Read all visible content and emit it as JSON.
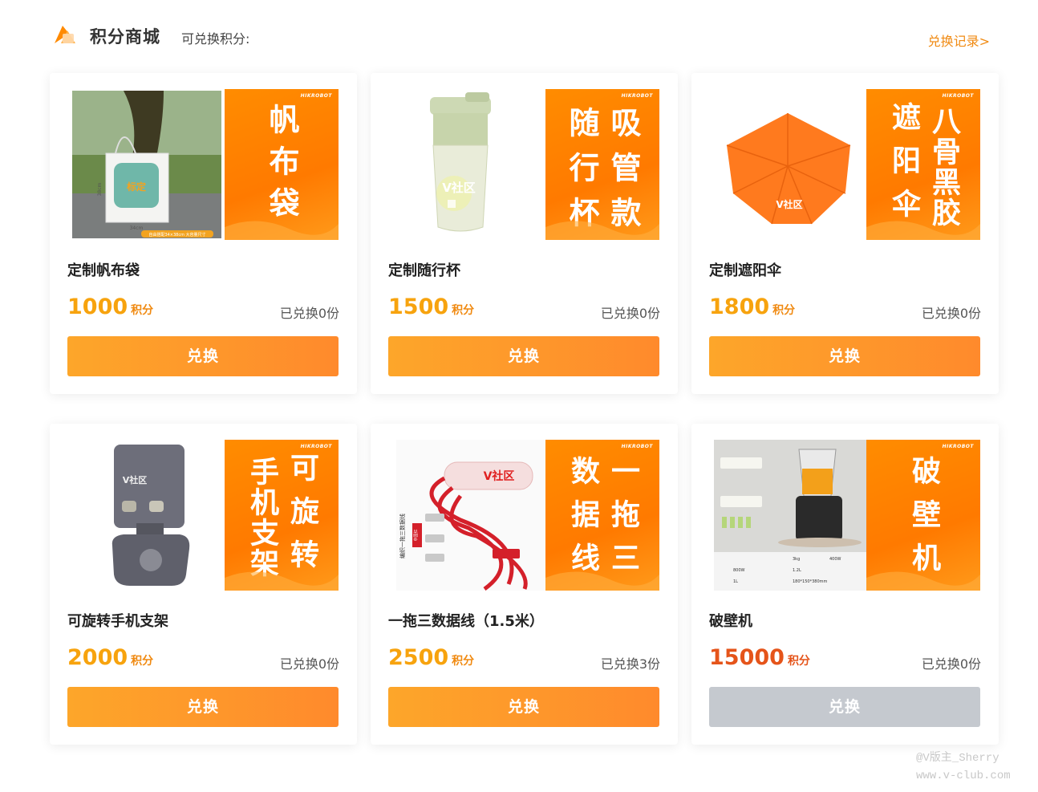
{
  "header": {
    "title": "积分商城",
    "points_label": "可兑换积分:",
    "history_link": "兑换记录>"
  },
  "colors": {
    "accent": "#ff8a00",
    "price": "#f7a30e",
    "price_high": "#e5541a",
    "button_disabled": "#c5c9cf"
  },
  "banner_brand": "HIKROBOT",
  "products": [
    {
      "name": "定制帆布袋",
      "price": "1000",
      "unit": "积分",
      "sold": "已兑换0份",
      "button": "兑换",
      "banner_cols": [
        "帆布袋"
      ],
      "photo_texts": [
        "标定",
        "34cm",
        "38cm",
        "自由搭配34×38cm 大容量尺寸"
      ],
      "enabled": true
    },
    {
      "name": "定制随行杯",
      "price": "1500",
      "unit": "积分",
      "sold": "已兑换0份",
      "button": "兑换",
      "banner_cols": [
        "吸管款",
        "随行杯"
      ],
      "photo_texts": [
        "V社区"
      ],
      "enabled": true
    },
    {
      "name": "定制遮阳伞",
      "price": "1800",
      "unit": "积分",
      "sold": "已兑换0份",
      "button": "兑换",
      "banner_cols": [
        "八骨黑胶",
        "遮阳伞"
      ],
      "photo_texts": [
        "V社区"
      ],
      "enabled": true
    },
    {
      "name": "可旋转手机支架",
      "price": "2000",
      "unit": "积分",
      "sold": "已兑换0份",
      "button": "兑换",
      "banner_cols": [
        "可旋转",
        "手机支架"
      ],
      "photo_texts": [
        "V社区"
      ],
      "enabled": true
    },
    {
      "name": "一拖三数据线（1.5米）",
      "price": "2500",
      "unit": "积分",
      "sold": "已兑换3份",
      "button": "兑换",
      "banner_cols": [
        "一拖三",
        "数据线"
      ],
      "photo_texts": [
        "V社区",
        "中国红",
        "编织一拖三数据线"
      ],
      "enabled": true
    },
    {
      "name": "破壁机",
      "price": "15000",
      "unit": "积分",
      "sold": "已兑换0份",
      "button": "兑换",
      "banner_cols": [
        "破壁机"
      ],
      "photo_texts": [
        "800W",
        "400W",
        "3kg",
        "1.2L",
        "1L",
        "180*150*380mm"
      ],
      "enabled": false
    }
  ],
  "watermark": [
    "@V版主_Sherry",
    "www.v-club.com"
  ]
}
